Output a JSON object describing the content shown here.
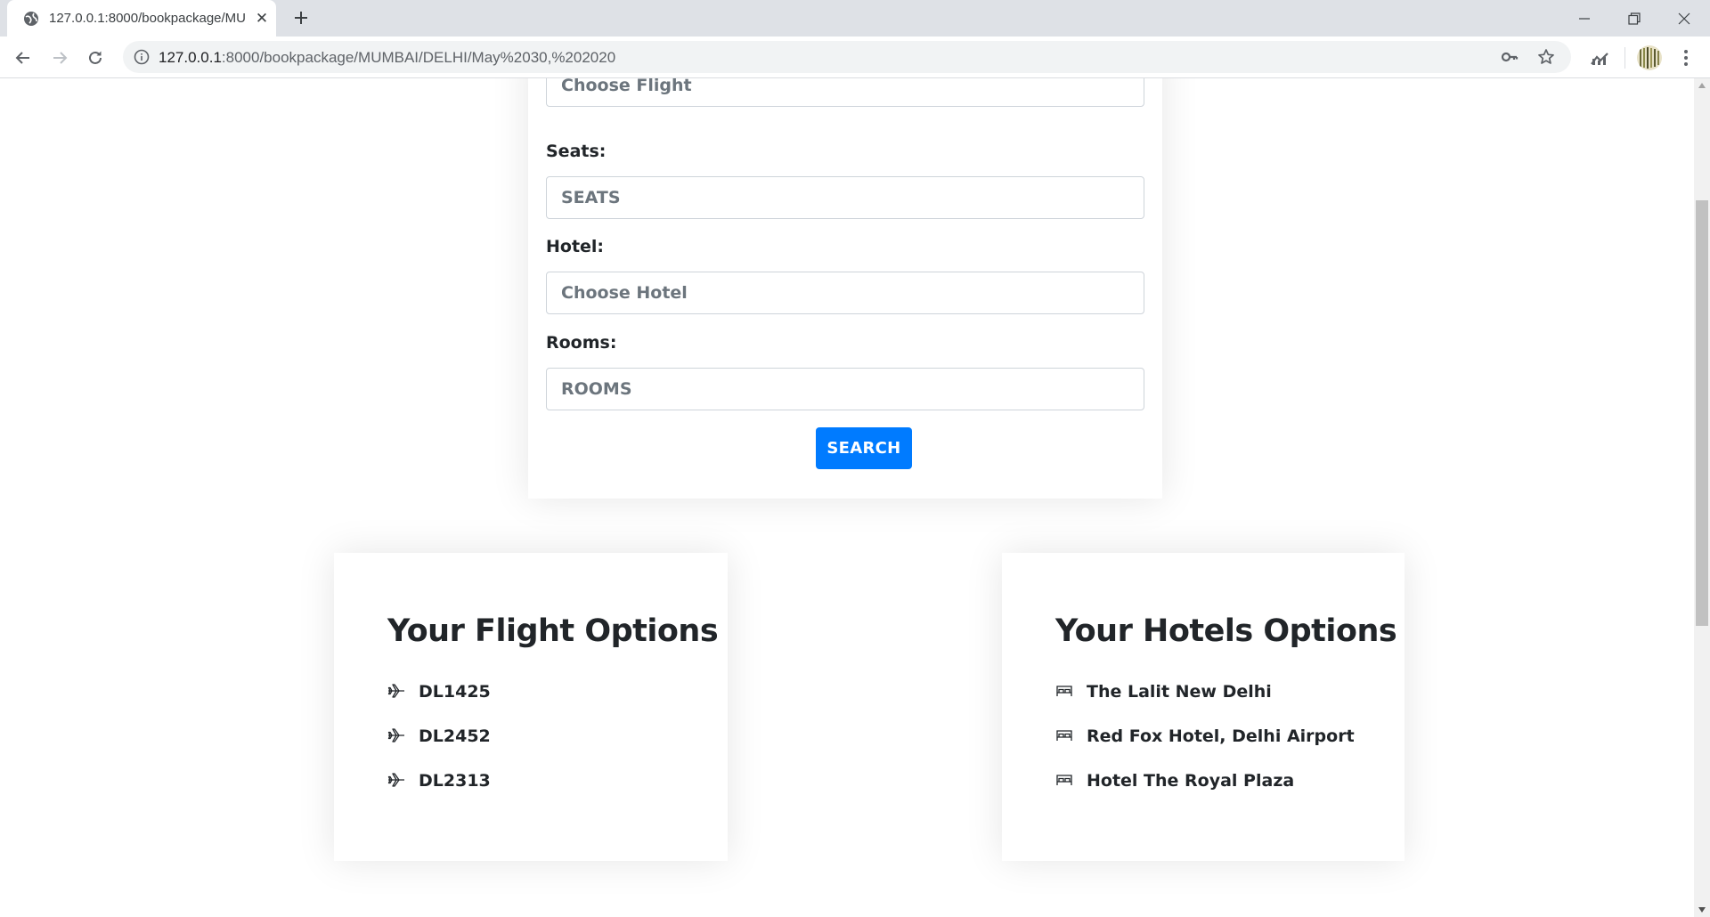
{
  "browser": {
    "tab_title": "127.0.0.1:8000/bookpackage/MU",
    "url_host": "127.0.0.1",
    "url_path": ":8000/bookpackage/MUMBAI/DELHI/May%2030,%202020"
  },
  "form": {
    "flight_placeholder": "Choose Flight",
    "seats_label": "Seats:",
    "seats_placeholder": "SEATS",
    "hotel_label": "Hotel:",
    "hotel_placeholder": "Choose Hotel",
    "rooms_label": "Rooms:",
    "rooms_placeholder": "ROOMS",
    "search_label": "SEARCH"
  },
  "flights": {
    "title": "Your Flight Options",
    "items": [
      "DL1425",
      "DL2452",
      "DL2313"
    ]
  },
  "hotels": {
    "title": "Your Hotels Options",
    "items": [
      "The Lalit New Delhi",
      "Red Fox Hotel, Delhi Airport",
      "Hotel The Royal Plaza"
    ]
  },
  "colors": {
    "primary": "#007bff",
    "text": "#212529",
    "placeholder": "#6c757d"
  }
}
